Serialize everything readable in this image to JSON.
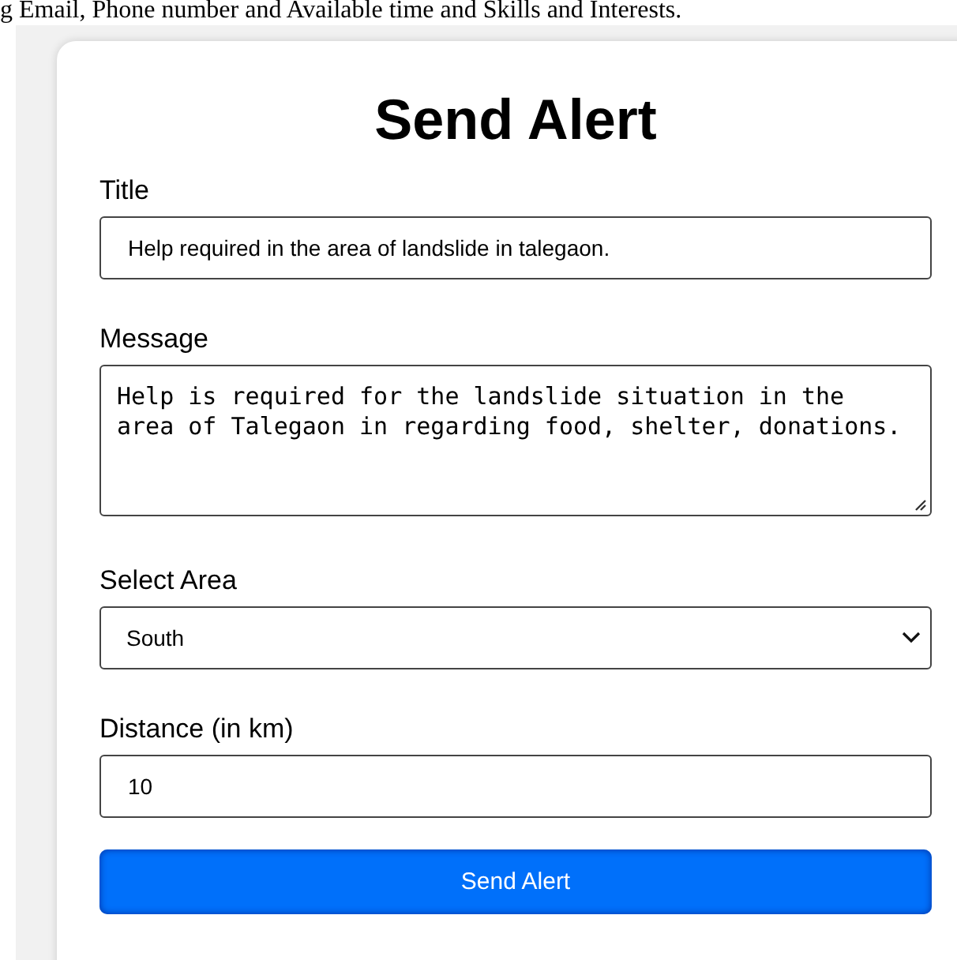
{
  "caption": "g Email, Phone number and Available time and Skills and Interests.",
  "heading": "Send Alert",
  "fields": [
    {
      "kind": "text",
      "label": "Title",
      "value": "Help required in the area of landslide in talegaon."
    },
    {
      "kind": "textarea",
      "label": "Message",
      "value": "Help is required for the landslide situation in the area of Talegaon in regarding food, shelter, donations."
    },
    {
      "kind": "select",
      "label": "Select Area",
      "value": "South"
    },
    {
      "kind": "text",
      "label": "Distance (in km)",
      "value": "10"
    }
  ],
  "button": "Send Alert"
}
